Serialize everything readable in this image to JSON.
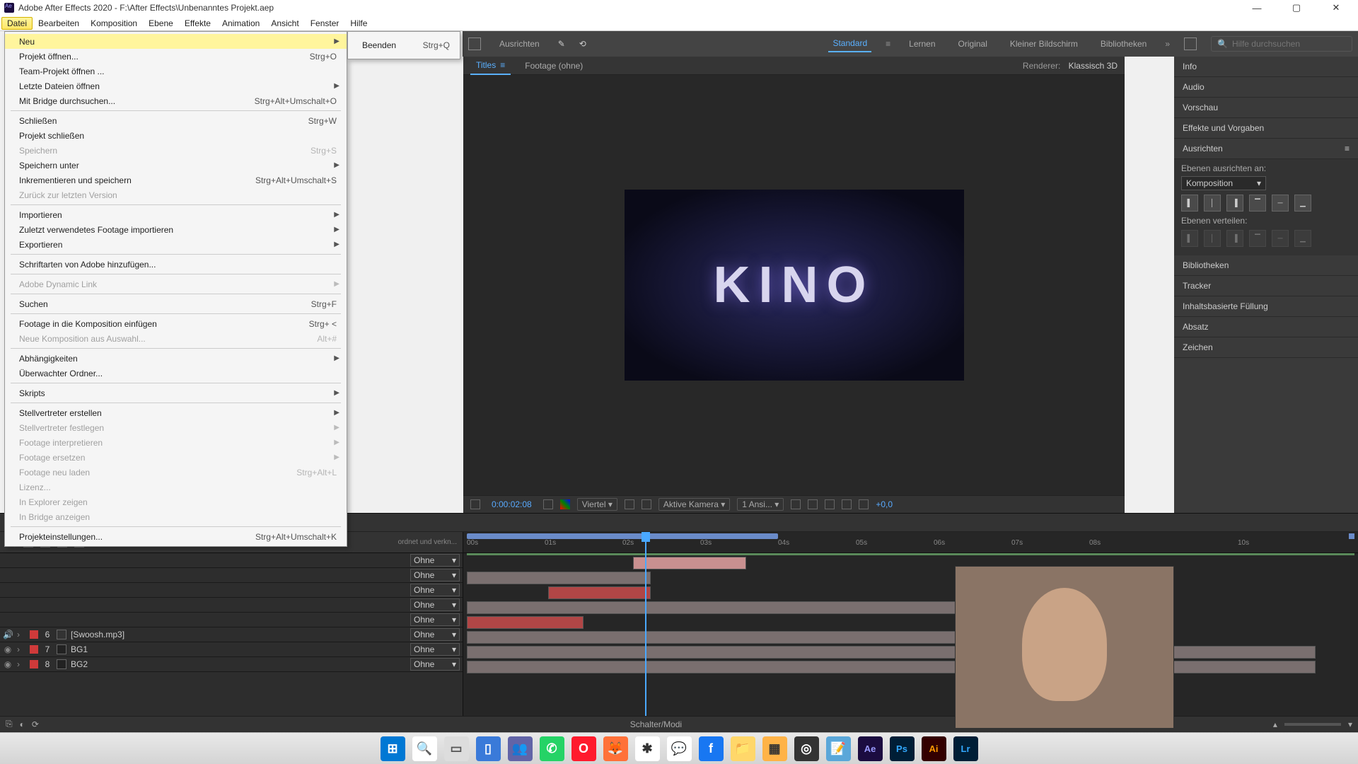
{
  "titlebar": {
    "text": "Adobe After Effects 2020 - F:\\After Effects\\Unbenanntes Projekt.aep"
  },
  "menubar": {
    "items": [
      "Datei",
      "Bearbeiten",
      "Komposition",
      "Ebene",
      "Effekte",
      "Animation",
      "Ansicht",
      "Fenster",
      "Hilfe"
    ]
  },
  "dropdown": {
    "groups": [
      [
        {
          "label": "Neu",
          "shortcut": "",
          "arrow": true,
          "disabled": false,
          "highlight": true
        },
        {
          "label": "Projekt öffnen...",
          "shortcut": "Strg+O",
          "arrow": false,
          "disabled": false
        },
        {
          "label": "Team-Projekt öffnen ...",
          "shortcut": "",
          "arrow": false,
          "disabled": false
        },
        {
          "label": "Letzte Dateien öffnen",
          "shortcut": "",
          "arrow": true,
          "disabled": false
        },
        {
          "label": "Mit Bridge durchsuchen...",
          "shortcut": "Strg+Alt+Umschalt+O",
          "arrow": false,
          "disabled": false
        }
      ],
      [
        {
          "label": "Schließen",
          "shortcut": "Strg+W",
          "arrow": false,
          "disabled": false
        },
        {
          "label": "Projekt schließen",
          "shortcut": "",
          "arrow": false,
          "disabled": false
        },
        {
          "label": "Speichern",
          "shortcut": "Strg+S",
          "arrow": false,
          "disabled": true
        },
        {
          "label": "Speichern unter",
          "shortcut": "",
          "arrow": true,
          "disabled": false
        },
        {
          "label": "Inkrementieren und speichern",
          "shortcut": "Strg+Alt+Umschalt+S",
          "arrow": false,
          "disabled": false
        },
        {
          "label": "Zurück zur letzten Version",
          "shortcut": "",
          "arrow": false,
          "disabled": true
        }
      ],
      [
        {
          "label": "Importieren",
          "shortcut": "",
          "arrow": true,
          "disabled": false
        },
        {
          "label": "Zuletzt verwendetes Footage importieren",
          "shortcut": "",
          "arrow": true,
          "disabled": false
        },
        {
          "label": "Exportieren",
          "shortcut": "",
          "arrow": true,
          "disabled": false
        }
      ],
      [
        {
          "label": "Schriftarten von Adobe hinzufügen...",
          "shortcut": "",
          "arrow": false,
          "disabled": false
        }
      ],
      [
        {
          "label": "Adobe Dynamic Link",
          "shortcut": "",
          "arrow": true,
          "disabled": true
        }
      ],
      [
        {
          "label": "Suchen",
          "shortcut": "Strg+F",
          "arrow": false,
          "disabled": false
        }
      ],
      [
        {
          "label": "Footage in die Komposition einfügen",
          "shortcut": "Strg+ <",
          "arrow": false,
          "disabled": false
        },
        {
          "label": "Neue Komposition aus Auswahl...",
          "shortcut": "Alt+#",
          "arrow": false,
          "disabled": true
        }
      ],
      [
        {
          "label": "Abhängigkeiten",
          "shortcut": "",
          "arrow": true,
          "disabled": false
        },
        {
          "label": "Überwachter Ordner...",
          "shortcut": "",
          "arrow": false,
          "disabled": false
        }
      ],
      [
        {
          "label": "Skripts",
          "shortcut": "",
          "arrow": true,
          "disabled": false
        }
      ],
      [
        {
          "label": "Stellvertreter erstellen",
          "shortcut": "",
          "arrow": true,
          "disabled": false
        },
        {
          "label": "Stellvertreter festlegen",
          "shortcut": "",
          "arrow": true,
          "disabled": true
        },
        {
          "label": "Footage interpretieren",
          "shortcut": "",
          "arrow": true,
          "disabled": true
        },
        {
          "label": "Footage ersetzen",
          "shortcut": "",
          "arrow": true,
          "disabled": true
        },
        {
          "label": "Footage neu laden",
          "shortcut": "Strg+Alt+L",
          "arrow": false,
          "disabled": true
        },
        {
          "label": "Lizenz...",
          "shortcut": "",
          "arrow": false,
          "disabled": true
        },
        {
          "label": "In Explorer zeigen",
          "shortcut": "",
          "arrow": false,
          "disabled": true
        },
        {
          "label": "In Bridge anzeigen",
          "shortcut": "",
          "arrow": false,
          "disabled": true
        }
      ],
      [
        {
          "label": "Projekteinstellungen...",
          "shortcut": "Strg+Alt+Umschalt+K",
          "arrow": false,
          "disabled": false
        }
      ]
    ]
  },
  "submenu": {
    "items": [
      {
        "label": "Beenden",
        "shortcut": "Strg+Q"
      }
    ]
  },
  "workspace": {
    "snap": "Ausrichten",
    "tabs": [
      "Standard",
      "Lernen",
      "Original",
      "Kleiner Bildschirm",
      "Bibliotheken"
    ],
    "search_placeholder": "Hilfe durchsuchen"
  },
  "comp": {
    "tab_active": "Titles",
    "tab_footage": "Footage (ohne)",
    "renderer_label": "Renderer:",
    "renderer_value": "Klassisch 3D"
  },
  "preview_text": "KINO",
  "viewer_footer": {
    "timecode": "0:00:02:08",
    "res": "Viertel",
    "camera": "Aktive Kamera",
    "views": "1 Ansi...",
    "exposure": "+0,0"
  },
  "right_panels": {
    "info": "Info",
    "audio": "Audio",
    "vorschau": "Vorschau",
    "effekte": "Effekte und Vorgaben",
    "ausrichten": "Ausrichten",
    "align_label": "Ebenen ausrichten an:",
    "align_target": "Komposition",
    "distribute": "Ebenen verteilen:",
    "bibliotheken": "Bibliotheken",
    "tracker": "Tracker",
    "inhaltsbasiert": "Inhaltsbasierte Füllung",
    "absatz": "Absatz",
    "zeichen": "Zeichen"
  },
  "timeline": {
    "header_text": "ordnet und verkn...",
    "ticks": [
      "00s",
      "01s",
      "02s",
      "03s",
      "04s",
      "05s",
      "06s",
      "07s",
      "08s",
      "10s"
    ],
    "none_label": "Ohne",
    "layers": [
      {
        "num": "6",
        "color": "#cf3a3a",
        "name": "[Swoosh.mp3]"
      },
      {
        "num": "7",
        "color": "#cf3a3a",
        "name": "BG1"
      },
      {
        "num": "8",
        "color": "#cf3a3a",
        "name": "BG2"
      }
    ],
    "footer": "Schalter/Modi"
  }
}
